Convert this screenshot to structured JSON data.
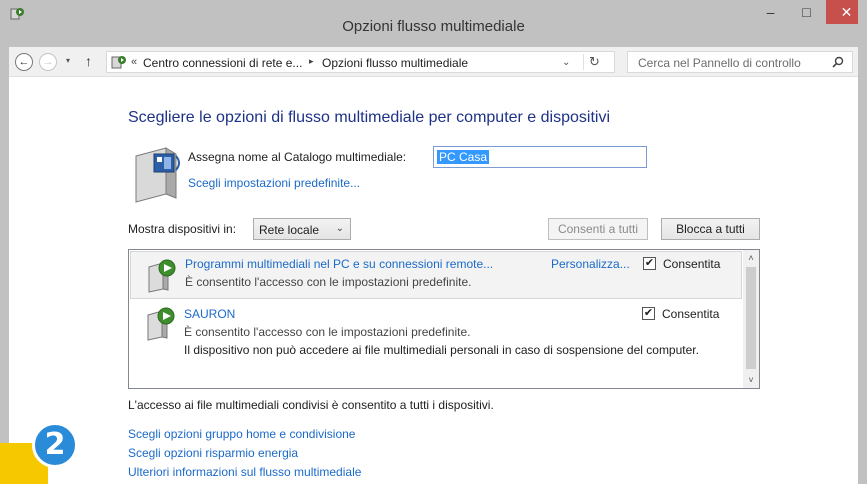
{
  "window": {
    "title": "Opzioni flusso multimediale",
    "controls": {
      "minimize": "–",
      "maximize": "□",
      "close": "✕"
    }
  },
  "nav": {
    "back": "←",
    "forward": "→",
    "dropdown": "▾",
    "up": "↑",
    "address": {
      "chevron": "«",
      "crumb1": "Centro connessioni di rete e...",
      "separator": "▸",
      "crumb2": "Opzioni flusso multimediale",
      "dropdown": "⌄",
      "refresh": "↻"
    },
    "search_placeholder": "Cerca nel Pannello di controllo"
  },
  "main": {
    "heading": "Scegliere le opzioni di flusso multimediale per computer e dispositivi",
    "library_label": "Assegna nome al Catalogo multimediale:",
    "library_value": "PC Casa",
    "defaults_link": "Scegli impostazioni predefinite...",
    "show_devices_label": "Mostra dispositivi in:",
    "show_devices_value": "Rete locale",
    "show_devices_arrow": "⌄",
    "allow_all": "Consenti a tutti",
    "block_all": "Blocca a tutti",
    "devices": [
      {
        "name": "Programmi multimediali nel PC e su connessioni remote...",
        "customize": "Personalizza...",
        "description": "È consentito l'accesso con le impostazioni predefinite.",
        "checked": "✔",
        "status": "Consentita"
      },
      {
        "name": "SAURON",
        "description": "È consentito l'accesso con le impostazioni predefinite.",
        "extra": "Il dispositivo non può accedere ai file multimediali personali in caso di sospensione del computer.",
        "checked": "✔",
        "status": "Consentita"
      }
    ],
    "scroll_up": "˄",
    "scroll_down": "˅",
    "note": "L'accesso ai file multimediali condivisi è consentito a tutti i dispositivi.",
    "links": {
      "homegroup": "Scegli opzioni gruppo home e condivisione",
      "power": "Scegli opzioni risparmio energia",
      "more_info": "Ulteriori informazioni sul flusso multimediale"
    }
  },
  "callout": {
    "number": "2"
  },
  "colors": {
    "title_bar": "#c1c1c1",
    "close_button": "#c7504d",
    "heading": "#1e3287",
    "link": "#1b6ac9",
    "selection": "#3399ff",
    "callout_badge": "#2a8bd8",
    "callout_arrow": "#f5c800"
  },
  "icons": {
    "app": "media-streaming-icon",
    "address": "control-panel-icon",
    "library": "media-server-icon",
    "device": "media-device-icon",
    "search": "search-icon"
  }
}
